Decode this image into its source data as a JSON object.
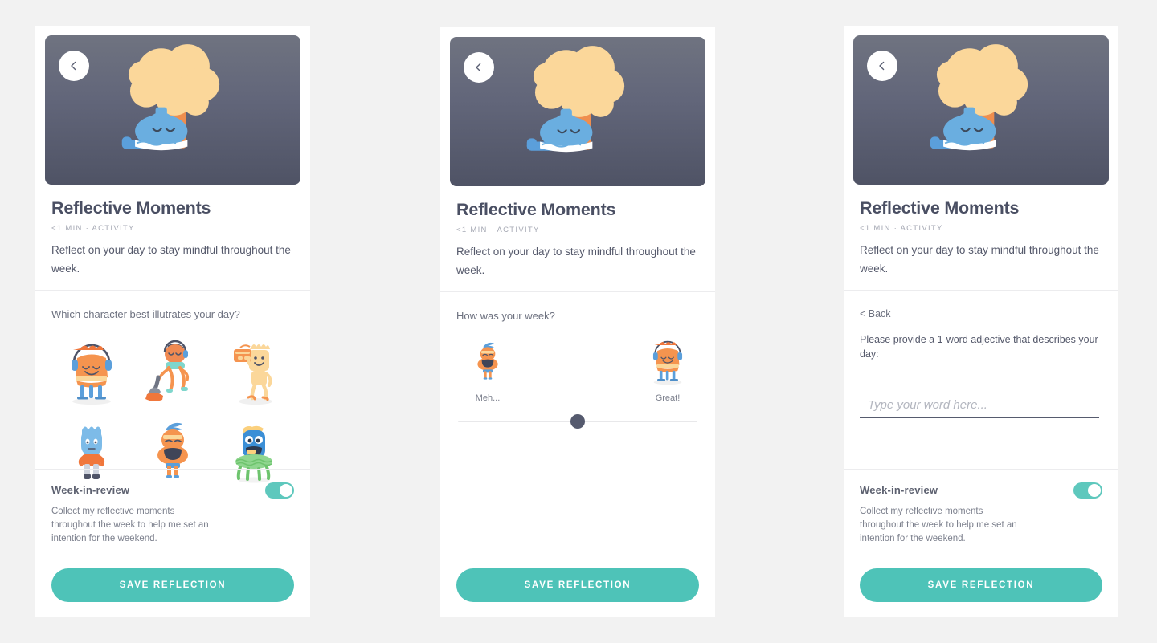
{
  "background_color": "#f2f2f2",
  "accent": {
    "teal": "#4ec3b8",
    "toggle_teal": "#5ec8bd",
    "slate": "#4a4f63",
    "orange": "#f5944f",
    "yellow": "#fbd08a",
    "blue": "#6aaee0"
  },
  "hero": {
    "back_icon": "chevron-left-icon",
    "gradient_from": "#6f7380",
    "gradient_to": "#4f5365",
    "illustration": "character-reading-under-tree"
  },
  "detail": {
    "title": "Reflective Moments",
    "meta": "<1 MIN  ·  ACTIVITY",
    "description": "Reflect on your day to stay mindful throughout the week."
  },
  "panel_1": {
    "prompt": "Which character best illutrates your day?",
    "characters": [
      {
        "id": "char-orange-headphones",
        "label": "orange-headphones-character"
      },
      {
        "id": "char-vacuuming",
        "label": "vacuuming-character"
      },
      {
        "id": "char-boombox",
        "label": "yellow-boombox-character"
      },
      {
        "id": "char-blue-standing",
        "label": "blue-standing-character"
      },
      {
        "id": "char-orange-grumpy",
        "label": "orange-grumpy-character"
      },
      {
        "id": "char-blue-cap",
        "label": "blue-cap-green-skirt-character"
      }
    ]
  },
  "panel_2": {
    "prompt": "How was your week?",
    "slider": {
      "low_label": "Meh...",
      "high_label": "Great!",
      "low_icon": "orange-grumpy-character",
      "high_icon": "orange-headphones-character",
      "value_percent": 50
    }
  },
  "panel_3": {
    "back_label": "< Back",
    "prompt": "Please provide a 1-word adjective that describes your day:",
    "input_value": "",
    "input_placeholder": "Type your word here..."
  },
  "week_in_review": {
    "title": "Week-in-review",
    "description": "Collect my reflective moments throughout the week to help me set an intention for the weekend.",
    "toggle_on": true
  },
  "save_button": {
    "label": "SAVE REFLECTION"
  }
}
